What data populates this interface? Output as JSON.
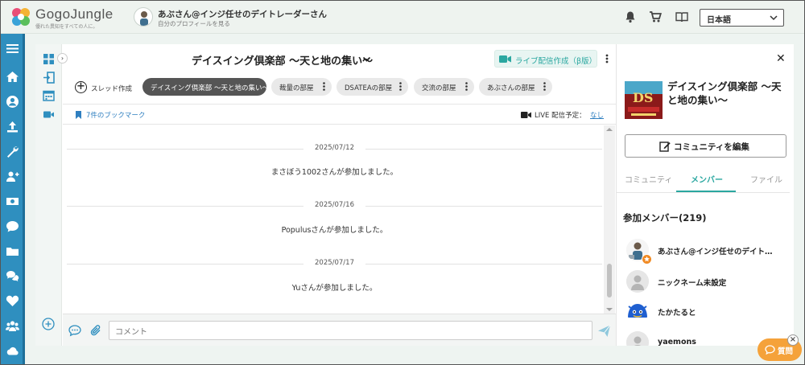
{
  "header": {
    "logo_text": "GogoJungle",
    "logo_tagline": "優れた異知をすべての人に。",
    "profile_name": "あぶさん@インジ任せのデイトレーダーさん",
    "profile_sub": "自分のプロフィールを見る",
    "language": "日本語",
    "icons": [
      "bell-icon",
      "cart-icon",
      "book-icon"
    ]
  },
  "sidebar": {
    "icons": [
      "menu-icon",
      "home-icon",
      "user-icon",
      "upload-icon",
      "tools-icon",
      "add-user-icon",
      "money-icon",
      "chat-icon",
      "folder-icon",
      "comments-icon",
      "heart-icon",
      "group-icon",
      "cloud-icon"
    ]
  },
  "room": {
    "title": "デイスイング倶楽部 〜天と地の集い〜",
    "live_button": "ライブ配信作成（β版）",
    "thread_create": "スレッド作成",
    "chips": [
      {
        "label": "デイスイング倶楽部 〜天と地の集い〜",
        "active": true
      },
      {
        "label": "裁量の部屋",
        "active": false
      },
      {
        "label": "DSATEAの部屋",
        "active": false
      },
      {
        "label": "交流の部屋",
        "active": false
      },
      {
        "label": "あぶさんの部屋",
        "active": false
      }
    ],
    "bookmarks": "7件のブックマーク",
    "live_plan_label": "LIVE 配信予定：",
    "live_plan_value": "なし"
  },
  "messages": [
    {
      "date": "2025/07/12",
      "text": "まさぼう1002さんが参加しました。"
    },
    {
      "date": "2025/07/16",
      "text": "Populusさんが参加しました。"
    },
    {
      "date": "2025/07/17",
      "text": "Yuさんが参加しました。"
    }
  ],
  "composer": {
    "placeholder": "コメント"
  },
  "community": {
    "title": "デイスイング倶楽部 〜天と地の集い〜",
    "edit_button": "コミュニティを編集",
    "tabs": [
      {
        "label": "コミュニティ",
        "active": false
      },
      {
        "label": "メンバー",
        "active": true
      },
      {
        "label": "ファイル",
        "active": false
      }
    ],
    "members_heading": "参加メンバー(219)",
    "members": [
      {
        "name": "あぶさん@インジ任せのデイトレ…",
        "owner": true
      },
      {
        "name": "ニックネーム未設定",
        "owner": false
      },
      {
        "name": "たかたると",
        "owner": false
      },
      {
        "name": "yaemons",
        "owner": false
      }
    ]
  },
  "help": {
    "label": "質問"
  },
  "colors": {
    "accent": "#2aa7a0",
    "sidebar": "#2f8fbf",
    "help_button": "#f5a23a",
    "active_chip": "#555555",
    "link": "#2f7fc0"
  }
}
